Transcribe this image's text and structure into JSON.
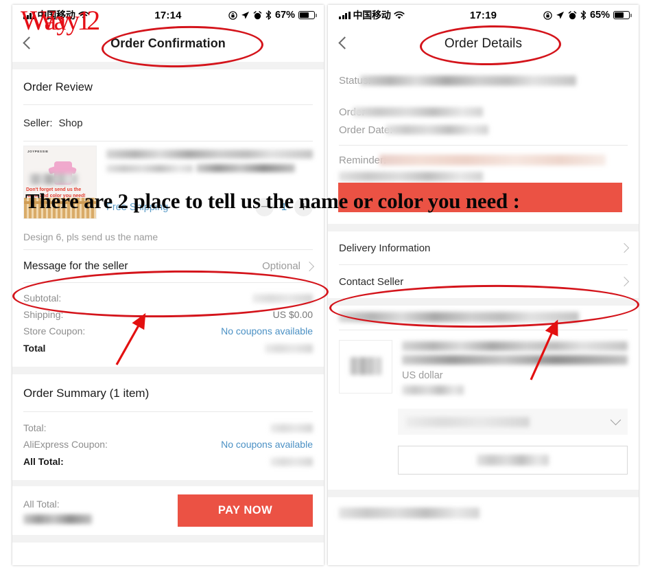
{
  "annotations": {
    "way1_label": "Way 1",
    "way2_label": "Way 2",
    "overlay_text": "There are 2 place to tell us the name or color you need :"
  },
  "left_phone": {
    "status_bar": {
      "carrier": "中国移动",
      "time": "17:14",
      "battery_percent": "67%",
      "icons": [
        "signal-bars-icon",
        "wifi-icon",
        "rotation-lock-icon",
        "location-arrow-icon",
        "alarm-clock-icon",
        "bluetooth-icon",
        "battery-icon"
      ]
    },
    "nav": {
      "title": "Order Confirmation",
      "back_icon": "chevron-left-icon"
    },
    "order_review": {
      "heading": "Order Review",
      "seller_label": "Seller:",
      "seller_name": "Shop",
      "product": {
        "thumbnail_brand": "JOYPESSIE",
        "thumbnail_caption": "Don't forget send us the name and color you need!",
        "title_redacted": true,
        "free_shipping": "Free Shipping",
        "quantity": "1",
        "minus_label": "−",
        "plus_label": "+"
      },
      "description": "Design 6, pls send us the name",
      "message_row": {
        "label": "Message for the seller",
        "value": "Optional",
        "chevron": "chevron-right-icon"
      },
      "totals": [
        {
          "label": "Subtotal:",
          "value": "",
          "redacted": true,
          "link": false
        },
        {
          "label": "Shipping:",
          "value": "US $0.00",
          "redacted": false,
          "link": false
        },
        {
          "label": "Store Coupon:",
          "value": "No coupons available",
          "redacted": false,
          "link": true
        },
        {
          "label": "Total",
          "value": "",
          "redacted": true,
          "link": false,
          "bold": true
        }
      ]
    },
    "order_summary": {
      "heading": "Order Summary (1 item)",
      "rows": [
        {
          "label": "Total:",
          "value": "",
          "redacted": true,
          "link": false
        },
        {
          "label": "AliExpress Coupon:",
          "value": "No coupons available",
          "redacted": false,
          "link": true
        },
        {
          "label": "All Total:",
          "value": "",
          "redacted": true,
          "link": false,
          "bold": true
        }
      ]
    },
    "pay_bar": {
      "all_total_label": "All Total:",
      "all_total_value_redacted": true,
      "pay_button": "PAY NOW"
    }
  },
  "right_phone": {
    "status_bar": {
      "carrier": "中国移动",
      "time": "17:19",
      "battery_percent": "65%",
      "icons": [
        "signal-bars-icon",
        "wifi-icon",
        "rotation-lock-icon",
        "location-arrow-icon",
        "alarm-clock-icon",
        "bluetooth-icon",
        "battery-icon"
      ]
    },
    "nav": {
      "title": "Order Details",
      "back_icon": "chevron-left-icon"
    },
    "info_rows": [
      {
        "label": "Status:",
        "redacted": true
      },
      {
        "label": "Order",
        "redacted": true
      },
      {
        "label": "Order Date:",
        "redacted": true
      },
      {
        "label": "Reminder:",
        "redacted": true
      }
    ],
    "menu_rows": [
      {
        "label": "Delivery Information",
        "chevron": "chevron-right-icon"
      },
      {
        "label": "Contact Seller",
        "chevron": "chevron-right-icon"
      }
    ],
    "product": {
      "title_redacted": true,
      "currency_note": "US dollar",
      "price_redacted": true
    },
    "select_row": {
      "value_redacted": true,
      "chevron": "chevron-down-icon"
    },
    "action_button": {
      "label_redacted": true
    }
  },
  "colors": {
    "brand_red": "#eb5244",
    "annotation_red": "#d4141b",
    "way_label_red": "#e50f17",
    "link_blue": "#4a90c4",
    "panel_bg": "#f2f2f2"
  }
}
